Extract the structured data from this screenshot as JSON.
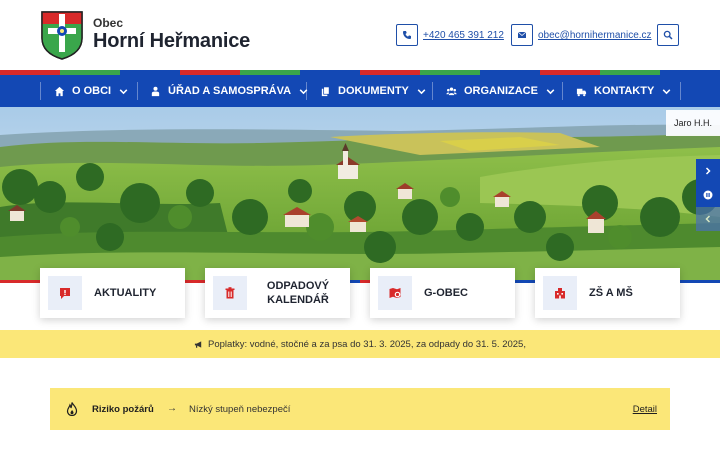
{
  "header": {
    "brand_small": "Obec",
    "brand_name": "Horní Heřmanice",
    "phone": "+420 465 391 212",
    "email": "obec@hornihermanice.cz"
  },
  "nav": {
    "items": [
      {
        "label": "O OBCI",
        "icon": "home-icon"
      },
      {
        "label": "ÚŘAD A SAMOSPRÁVA",
        "icon": "official-icon"
      },
      {
        "label": "DOKUMENTY",
        "icon": "documents-icon"
      },
      {
        "label": "ORGANIZACE",
        "icon": "people-icon"
      },
      {
        "label": "KONTAKTY",
        "icon": "contacts-icon"
      }
    ]
  },
  "hero": {
    "photo_credit": "Jaro H.H."
  },
  "cards": [
    {
      "label": "AKTUALITY",
      "icon": "news-icon"
    },
    {
      "label": "ODPADOVÝ KALENDÁŘ",
      "icon": "trash-icon"
    },
    {
      "label": "G-OBEC",
      "icon": "map-marker-icon"
    },
    {
      "label": "ZŠ A MŠ",
      "icon": "school-icon"
    }
  ],
  "notice": {
    "text": "Poplatky: vodné, stočné a za psa do 31. 3. 2025, za odpady do 31. 5. 2025,"
  },
  "fire": {
    "title": "Riziko požárů",
    "arrow": "→",
    "text": "Nízký stupeň nebezpečí",
    "detail": "Detail"
  },
  "colors": {
    "primary": "#1348b4",
    "notice_bg": "#fbe778",
    "stripe_red": "#d82a2a",
    "stripe_green": "#3aa64b",
    "stripe_blue": "#1348b4"
  }
}
